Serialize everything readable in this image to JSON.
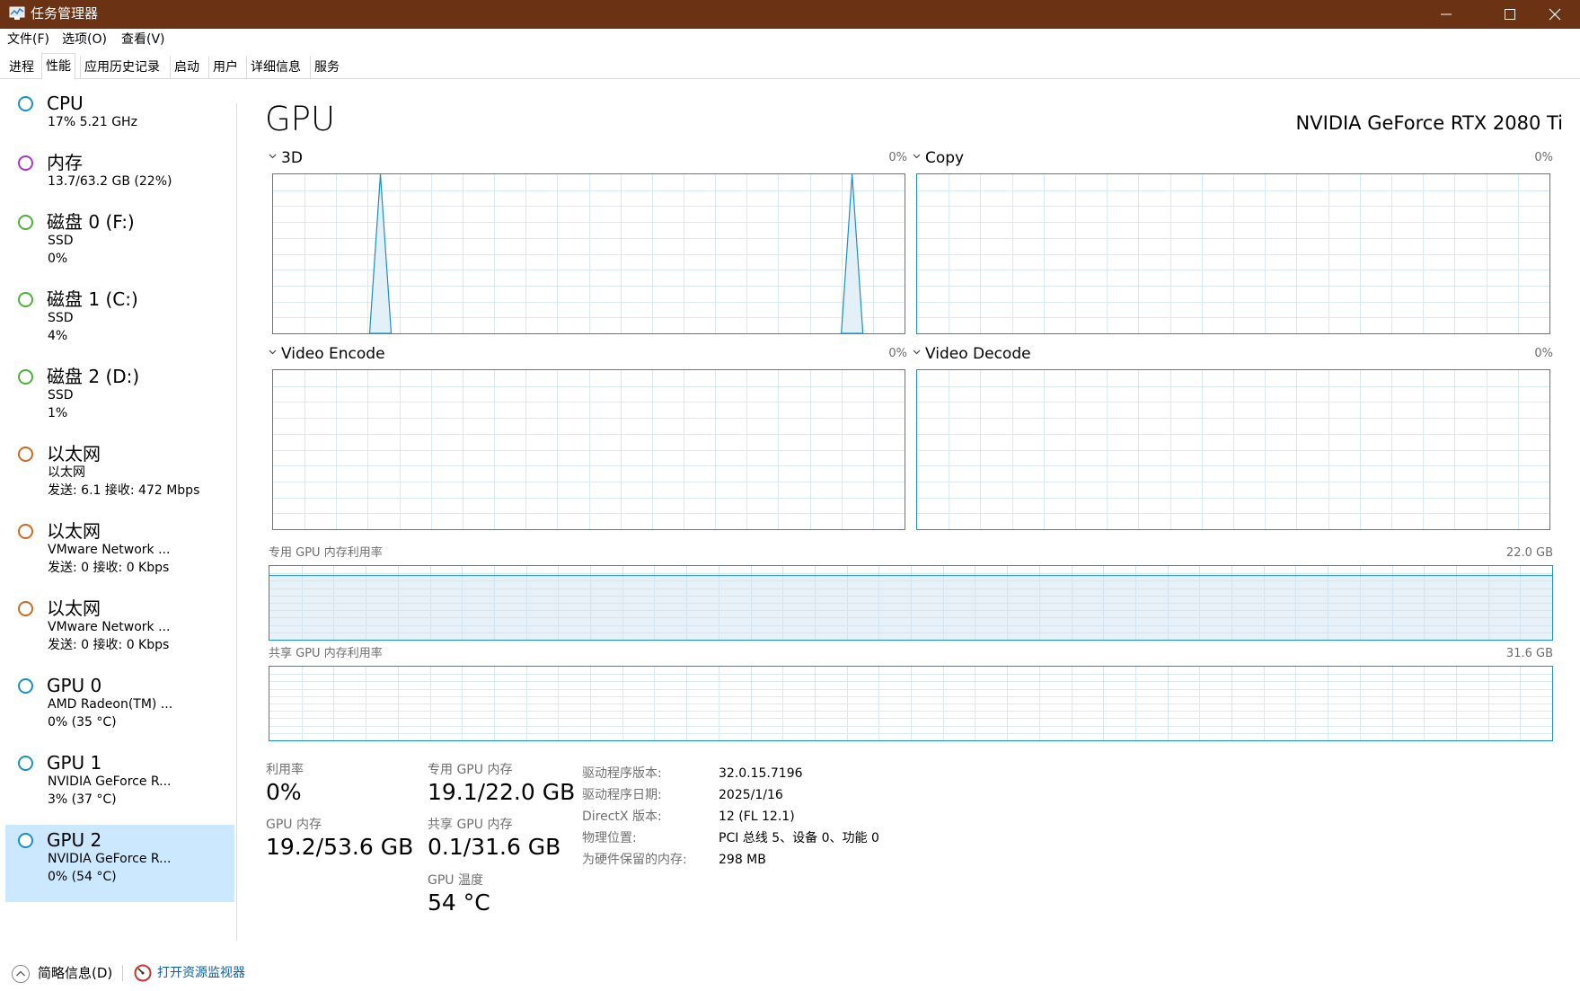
{
  "window": {
    "title": "任务管理器",
    "minimize_label": "最小化",
    "maximize_label": "最大化",
    "close_label": "关闭"
  },
  "menu": [
    "文件(F)",
    "选项(O)",
    "查看(V)"
  ],
  "tabs": [
    {
      "label": "进程"
    },
    {
      "label": "性能"
    },
    {
      "label": "应用历史记录"
    },
    {
      "label": "启动"
    },
    {
      "label": "用户"
    },
    {
      "label": "详细信息"
    },
    {
      "label": "服务"
    }
  ],
  "sidebar": {
    "items": [
      {
        "title": "CPU",
        "sub": "17%  5.21 GHz",
        "sub2": "",
        "color": "#1a8fc8"
      },
      {
        "title": "内存",
        "sub": "13.7/63.2 GB (22%)",
        "sub2": "",
        "color": "#a438c8"
      },
      {
        "title": "磁盘 0 (F:)",
        "sub": "SSD",
        "sub2": "0%",
        "color": "#4db03a"
      },
      {
        "title": "磁盘 1 (C:)",
        "sub": "SSD",
        "sub2": "4%",
        "color": "#4db03a"
      },
      {
        "title": "磁盘 2 (D:)",
        "sub": "SSD",
        "sub2": "1%",
        "color": "#4db03a"
      },
      {
        "title": "以太网",
        "sub": "以太网",
        "sub2": "发送: 6.1  接收: 472 Mbps",
        "color": "#c76a2a"
      },
      {
        "title": "以太网",
        "sub": "VMware Network ...",
        "sub2": "发送: 0  接收: 0 Kbps",
        "color": "#c76a2a"
      },
      {
        "title": "以太网",
        "sub": "VMware Network ...",
        "sub2": "发送: 0  接收: 0 Kbps",
        "color": "#c76a2a"
      },
      {
        "title": "GPU 0",
        "sub": "AMD Radeon(TM) ...",
        "sub2": "0%  (35 °C)",
        "color": "#1a8fc8"
      },
      {
        "title": "GPU 1",
        "sub": "NVIDIA GeForce R...",
        "sub2": "3%  (37 °C)",
        "color": "#1a8fc8"
      },
      {
        "title": "GPU 2",
        "sub": "NVIDIA GeForce R...",
        "sub2": "0%  (54 °C)",
        "color": "#1a8fc8",
        "selected": true
      }
    ]
  },
  "main": {
    "title": "GPU",
    "gpu_name": "NVIDIA GeForce RTX 2080 Ti",
    "engines": [
      {
        "name": "3D",
        "pct": "0%",
        "spikes_percent": [
          100,
          100
        ]
      },
      {
        "name": "Copy",
        "pct": "0%"
      },
      {
        "name": "Video Encode",
        "pct": "0%"
      },
      {
        "name": "Video Decode",
        "pct": "0%"
      }
    ],
    "dedicated_label": "专用 GPU 内存利用率",
    "dedicated_max": "22.0 GB",
    "dedicated_fill_fraction": 0.87,
    "shared_label": "共享 GPU 内存利用率",
    "shared_max": "31.6 GB",
    "shared_fill_fraction": 0.003
  },
  "stats": {
    "utilization_label": "利用率",
    "utilization_value": "0%",
    "gpu_mem_label": "GPU 内存",
    "gpu_mem_value": "19.2/53.6 GB",
    "dedicated_mem_label": "专用 GPU 内存",
    "dedicated_mem_value": "19.1/22.0 GB",
    "shared_mem_label": "共享 GPU 内存",
    "shared_mem_value": "0.1/31.6 GB",
    "temp_label": "GPU 温度",
    "temp_value": "54 °C"
  },
  "info": [
    {
      "key": "驱动程序版本:",
      "value": "32.0.15.7196"
    },
    {
      "key": "驱动程序日期:",
      "value": "2025/1/16"
    },
    {
      "key": "DirectX 版本:",
      "value": "12 (FL 12.1)"
    },
    {
      "key": "物理位置:",
      "value": "PCI 总线 5、设备 0、功能 0"
    },
    {
      "key": "为硬件保留的内存:",
      "value": "298 MB"
    }
  ],
  "footer": {
    "fewer_details": "简略信息(D)",
    "resource_monitor": "打开资源监视器"
  }
}
